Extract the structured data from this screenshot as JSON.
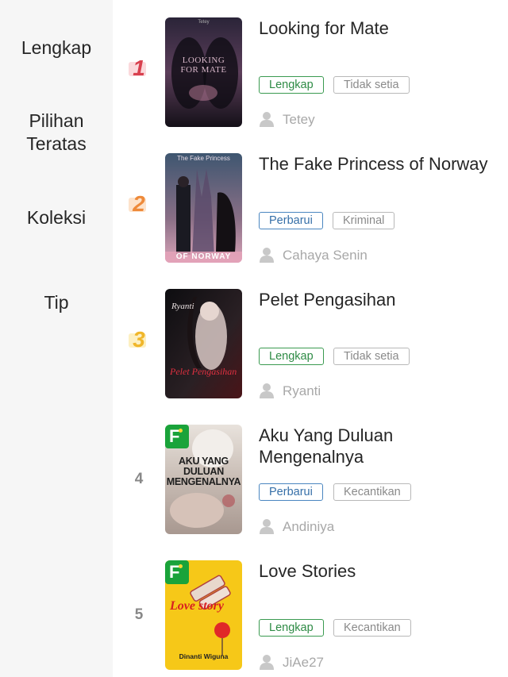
{
  "sidebar": {
    "items": [
      {
        "label": "Lengkap"
      },
      {
        "label": "Pilihan\nTeratas"
      },
      {
        "label": "Koleksi"
      },
      {
        "label": "Tip"
      }
    ]
  },
  "list": {
    "items": [
      {
        "rank": "1",
        "title": "Looking for Mate",
        "status": "Lengkap",
        "genre": "Tidak setia",
        "author": "Tetey",
        "cover_text": "LOOKING\nFOR MATE",
        "cover_top": "Tetey"
      },
      {
        "rank": "2",
        "title": "The Fake Princess of Norway",
        "status": "Perbarui",
        "genre": "Kriminal",
        "author": "Cahaya Senin",
        "cover_text": "OF NORWAY",
        "cover_top": "The Fake Princess"
      },
      {
        "rank": "3",
        "title": "Pelet Pengasihan",
        "status": "Lengkap",
        "genre": "Tidak setia",
        "author": "Ryanti",
        "cover_text": "Pelet Pengasihan",
        "cover_top": "Ryanti"
      },
      {
        "rank": "4",
        "title": "Aku Yang Duluan Mengenalnya",
        "status": "Perbarui",
        "genre": "Kecantikan",
        "author": "Andiniya",
        "cover_text": "AKU YANG\nDULUAN\nMENGENALNYA",
        "badge": "F"
      },
      {
        "rank": "5",
        "title": "Love Stories",
        "status": "Lengkap",
        "genre": "Kecantikan",
        "author": "JiAe27",
        "cover_text": "Love story",
        "cover_bottom": "Dinanti Wiguna",
        "badge": "F"
      }
    ]
  },
  "colors": {
    "sidebar_bg": "#f6f6f6",
    "rank1": "#d8404e",
    "rank2": "#ee8a3a",
    "rank3": "#f0b62a",
    "tag_green": "#3a9a50",
    "tag_blue": "#4a86c0",
    "badge_green": "#1aa33a"
  },
  "icons": [
    "person-icon",
    "f-badge-icon"
  ]
}
